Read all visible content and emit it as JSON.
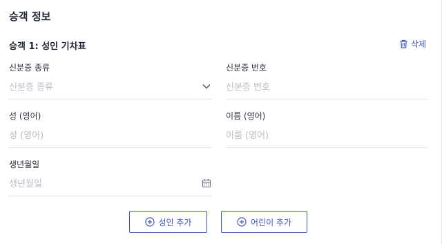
{
  "section": {
    "title": "승객 정보"
  },
  "passenger": {
    "title": "승객 1: 성인 기차표",
    "delete_label": "삭제"
  },
  "fields": {
    "id_type": {
      "label": "신분증 종류",
      "placeholder": "신분증 종류",
      "value": "",
      "icon": "chevron-down-icon"
    },
    "id_number": {
      "label": "신분증 번호",
      "placeholder": "신분증 번호",
      "value": ""
    },
    "surname": {
      "label": "성 (영어)",
      "placeholder": "성 (영어)",
      "value": ""
    },
    "given_name": {
      "label": "이름 (영어)",
      "placeholder": "이름 (영어)",
      "value": ""
    },
    "birthdate": {
      "label": "생년월일",
      "placeholder": "생년월일",
      "value": "",
      "icon": "calendar-icon"
    }
  },
  "actions": {
    "add_adult": "성인 추가",
    "add_child": "어린이 추가"
  },
  "colors": {
    "accent": "#3f55c4",
    "text": "#1f2533",
    "placeholder": "#b9bdc7",
    "divider": "#e3e6ec"
  }
}
